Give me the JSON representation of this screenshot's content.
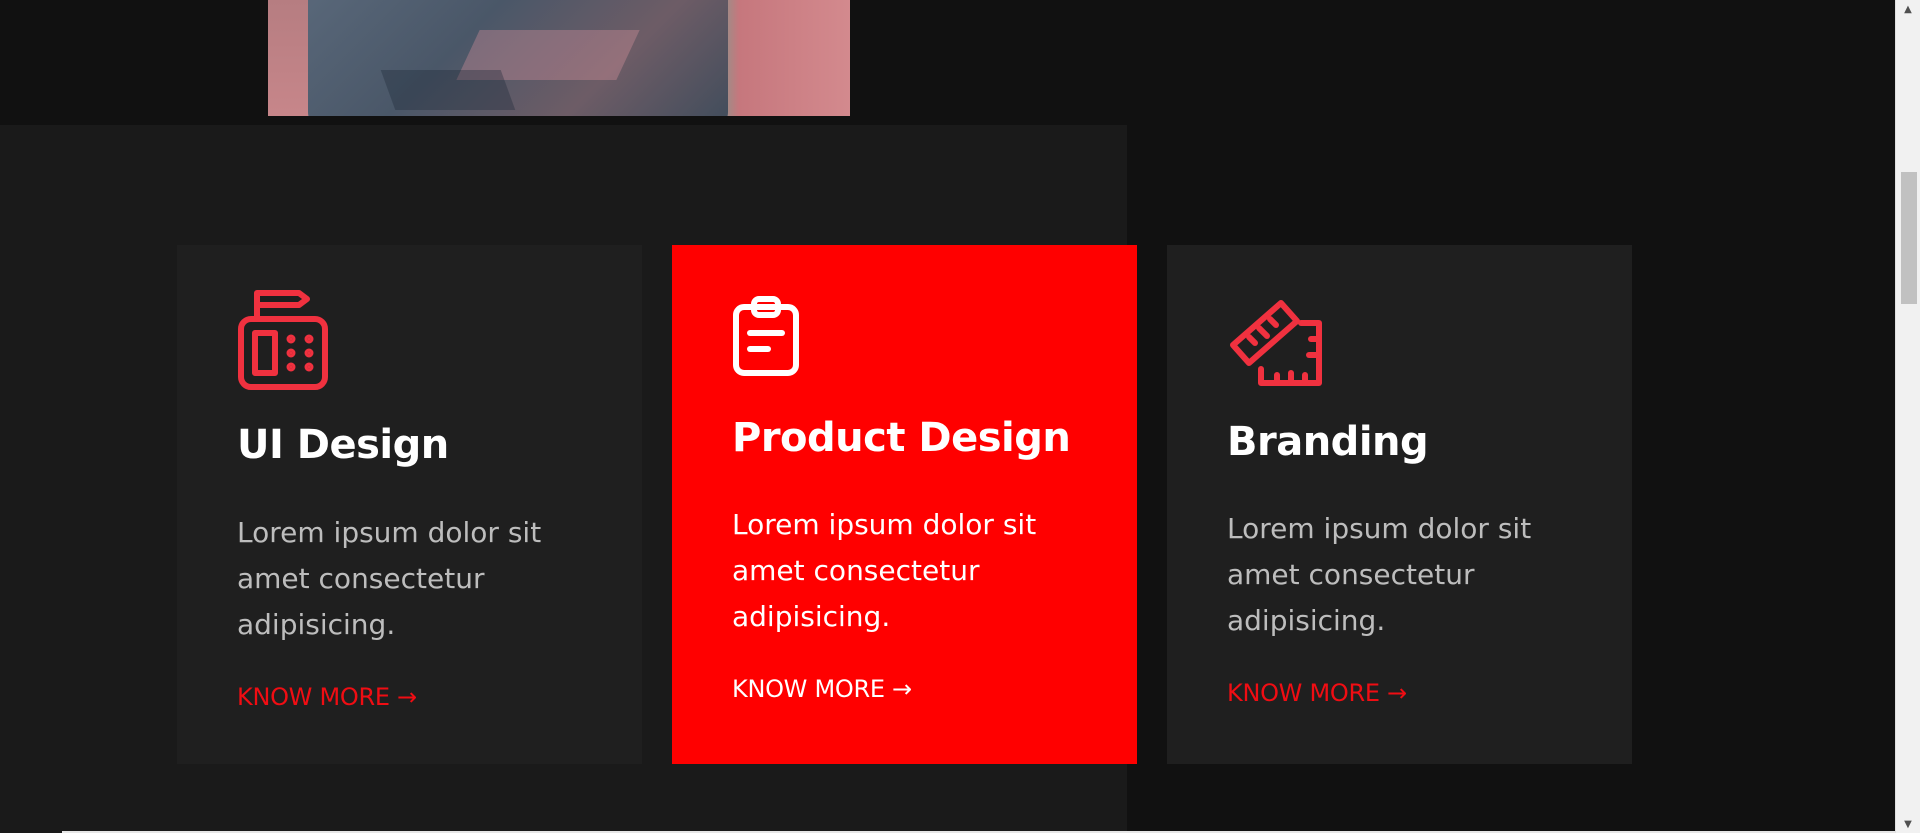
{
  "services": [
    {
      "icon": "cash-register-icon",
      "title": "UI Design",
      "description": "Lorem ipsum dolor sit amet consectetur adipisicing.",
      "link": "KNOW MORE →"
    },
    {
      "icon": "clipboard-icon",
      "title": "Product Design",
      "description": "Lorem ipsum dolor sit amet consectetur adipisicing.",
      "link": "KNOW MORE →"
    },
    {
      "icon": "ruler-icon",
      "title": "Branding",
      "description": "Lorem ipsum dolor sit amet consectetur adipisicing.",
      "link": "KNOW MORE →"
    }
  ],
  "colors": {
    "accent": "#ff0000",
    "background": "#111111",
    "panel": "#1a1a1a",
    "card": "#1f1f1f"
  },
  "scrollbar": {
    "up": "▲",
    "down": "▼"
  }
}
